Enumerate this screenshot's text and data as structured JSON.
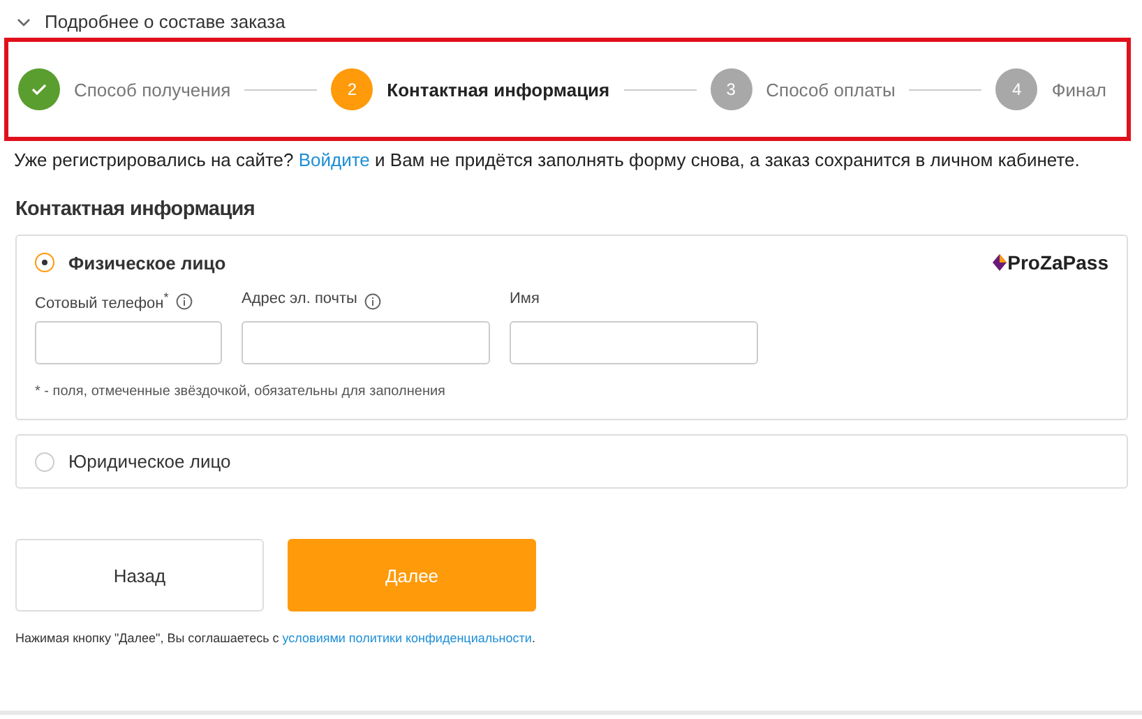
{
  "order_details": {
    "label": "Подробнее о составе заказа",
    "expanded": false
  },
  "steps": [
    {
      "label": "Способ получения",
      "done": true,
      "selected": false
    },
    {
      "number": "2",
      "label": "Контактная информация",
      "done": false,
      "selected": true
    },
    {
      "number": "3",
      "label": "Способ оплаты",
      "done": false,
      "selected": false
    },
    {
      "number": "4",
      "label": "Финал",
      "done": false,
      "selected": false
    }
  ],
  "login_hint": {
    "before": "Уже регистрировались на сайте? ",
    "link": "Войдите",
    "after": " и Вам не придётся заполнять форму снова, а заказ сохранится в личном кабинете."
  },
  "section_title": "Контактная информация",
  "person_types": [
    {
      "label": "Физическое лицо",
      "selected": true,
      "logo": "ProZaPass",
      "fields": [
        {
          "label": "Сотовый телефон",
          "marker": "*",
          "info": true
        },
        {
          "label": "Адрес эл. почты",
          "info": true
        },
        {
          "label": "Имя",
          "info": false
        }
      ],
      "note": "* - поля, отмеченные звёздочкой, обязательны для заполнения"
    },
    {
      "label": "Юридическое лицо",
      "selected": false
    }
  ],
  "buttons": [
    {
      "label": "Назад",
      "kind": "secondary"
    },
    {
      "label": "Далее",
      "kind": "primary"
    }
  ],
  "consent": {
    "before": "Нажимая кнопку \"Далее\", Вы соглашаетесь с ",
    "link": "условиями политики конфиденциальности",
    "after": "."
  }
}
